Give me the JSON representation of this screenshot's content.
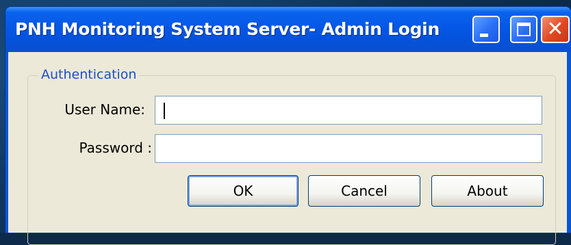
{
  "window": {
    "title": "PNH Monitoring System Server- Admin Login",
    "controls": {
      "minimize": "minimize-icon",
      "maximize": "maximize-icon",
      "close": "close-icon"
    }
  },
  "auth": {
    "group_label": "Authentication",
    "username_label": "User Name:",
    "username_value": "",
    "password_label": "Password :",
    "password_value": ""
  },
  "buttons": {
    "ok": "OK",
    "cancel": "Cancel",
    "about": "About"
  },
  "colors": {
    "titlebar": "#0557e6",
    "close_button": "#e0481f",
    "dialog_bg": "#ece9d8",
    "group_label": "#1e4fc7"
  }
}
